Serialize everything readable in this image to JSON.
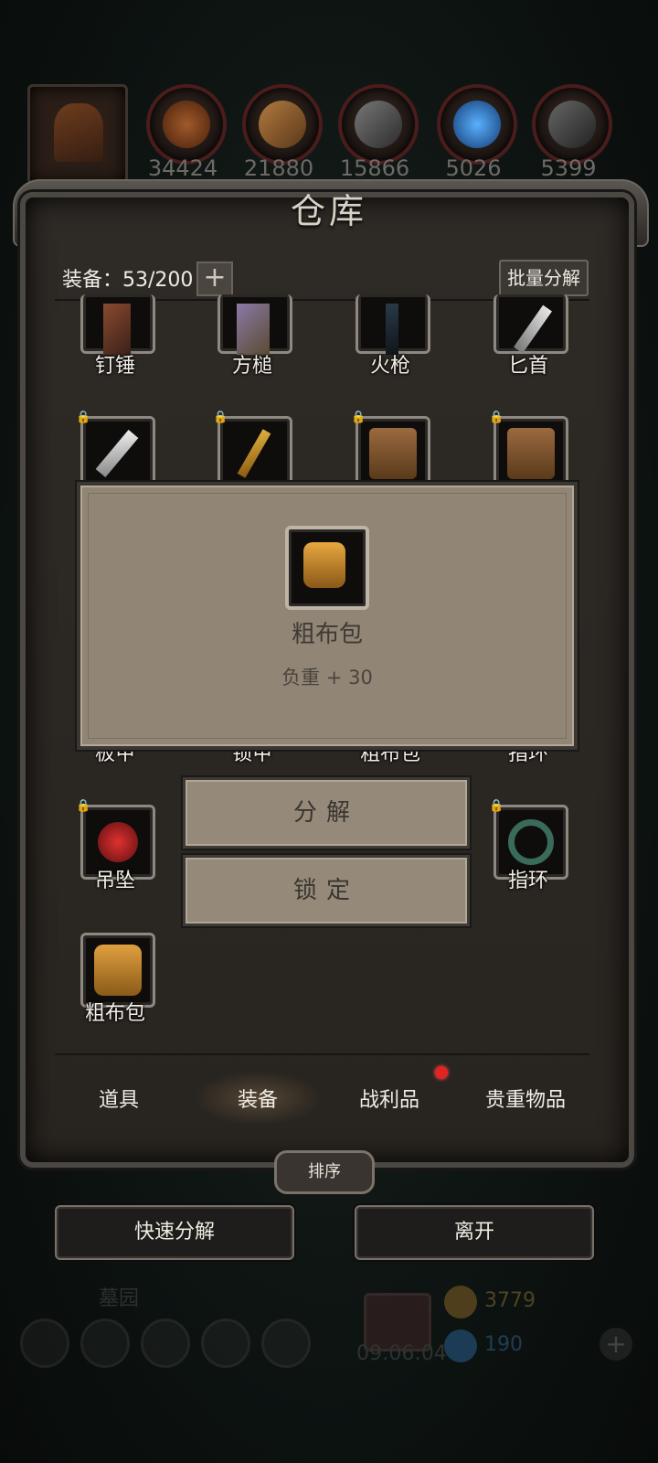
{
  "resources": [
    {
      "icon": "leather-icon",
      "value": "34424",
      "color": "#7a3a18"
    },
    {
      "icon": "wood-plank-icon",
      "value": "21880",
      "color": "#8a5a2a"
    },
    {
      "icon": "iron-ingot-icon",
      "value": "15866",
      "color": "#5a5a5a"
    },
    {
      "icon": "crystal-icon",
      "value": "5026",
      "color": "#2a6aa8"
    },
    {
      "icon": "steel-ingot-icon",
      "value": "5399",
      "color": "#4a4a4a"
    }
  ],
  "panel": {
    "title": "仓库",
    "equip_count": "装备：53/200",
    "plus": "+",
    "batch_decompose": "批量分解"
  },
  "items": [
    {
      "label": "钉锤",
      "icon": "hammer-icon"
    },
    {
      "label": "方槌",
      "icon": "mallet-icon"
    },
    {
      "label": "火枪",
      "icon": "musket-icon"
    },
    {
      "label": "匕首",
      "icon": "dagger-icon"
    },
    {
      "label": "",
      "icon": "curved-dagger-icon"
    },
    {
      "label": "",
      "icon": "golden-staff-icon"
    },
    {
      "label": "",
      "icon": "cloth-armor-icon"
    },
    {
      "label": "",
      "icon": "cloth-armor-icon"
    },
    {
      "label": "板甲",
      "icon": "plate-armor-icon"
    },
    {
      "label": "锁甲",
      "icon": "chain-armor-icon"
    },
    {
      "label": "粗布包",
      "icon": "cloth-bag-icon"
    },
    {
      "label": "指环",
      "icon": "ring-icon"
    },
    {
      "label": "吊坠",
      "icon": "pendant-icon"
    },
    {
      "label": "指环",
      "icon": "ring-icon"
    },
    {
      "label": "粗布包",
      "icon": "cloth-bag-icon"
    }
  ],
  "popup": {
    "name": "粗布包",
    "stat": "负重 + 30"
  },
  "actions": {
    "decompose": "分解",
    "lock": "锁定"
  },
  "tabs": [
    "道具",
    "装备",
    "战利品",
    "贵重物品"
  ],
  "sort": "排序",
  "buttons": {
    "quick_decompose": "快速分解",
    "leave": "离开"
  },
  "footer": {
    "location": "墓园",
    "timer": "09:06:04",
    "gold": "3779",
    "gems": "190"
  }
}
